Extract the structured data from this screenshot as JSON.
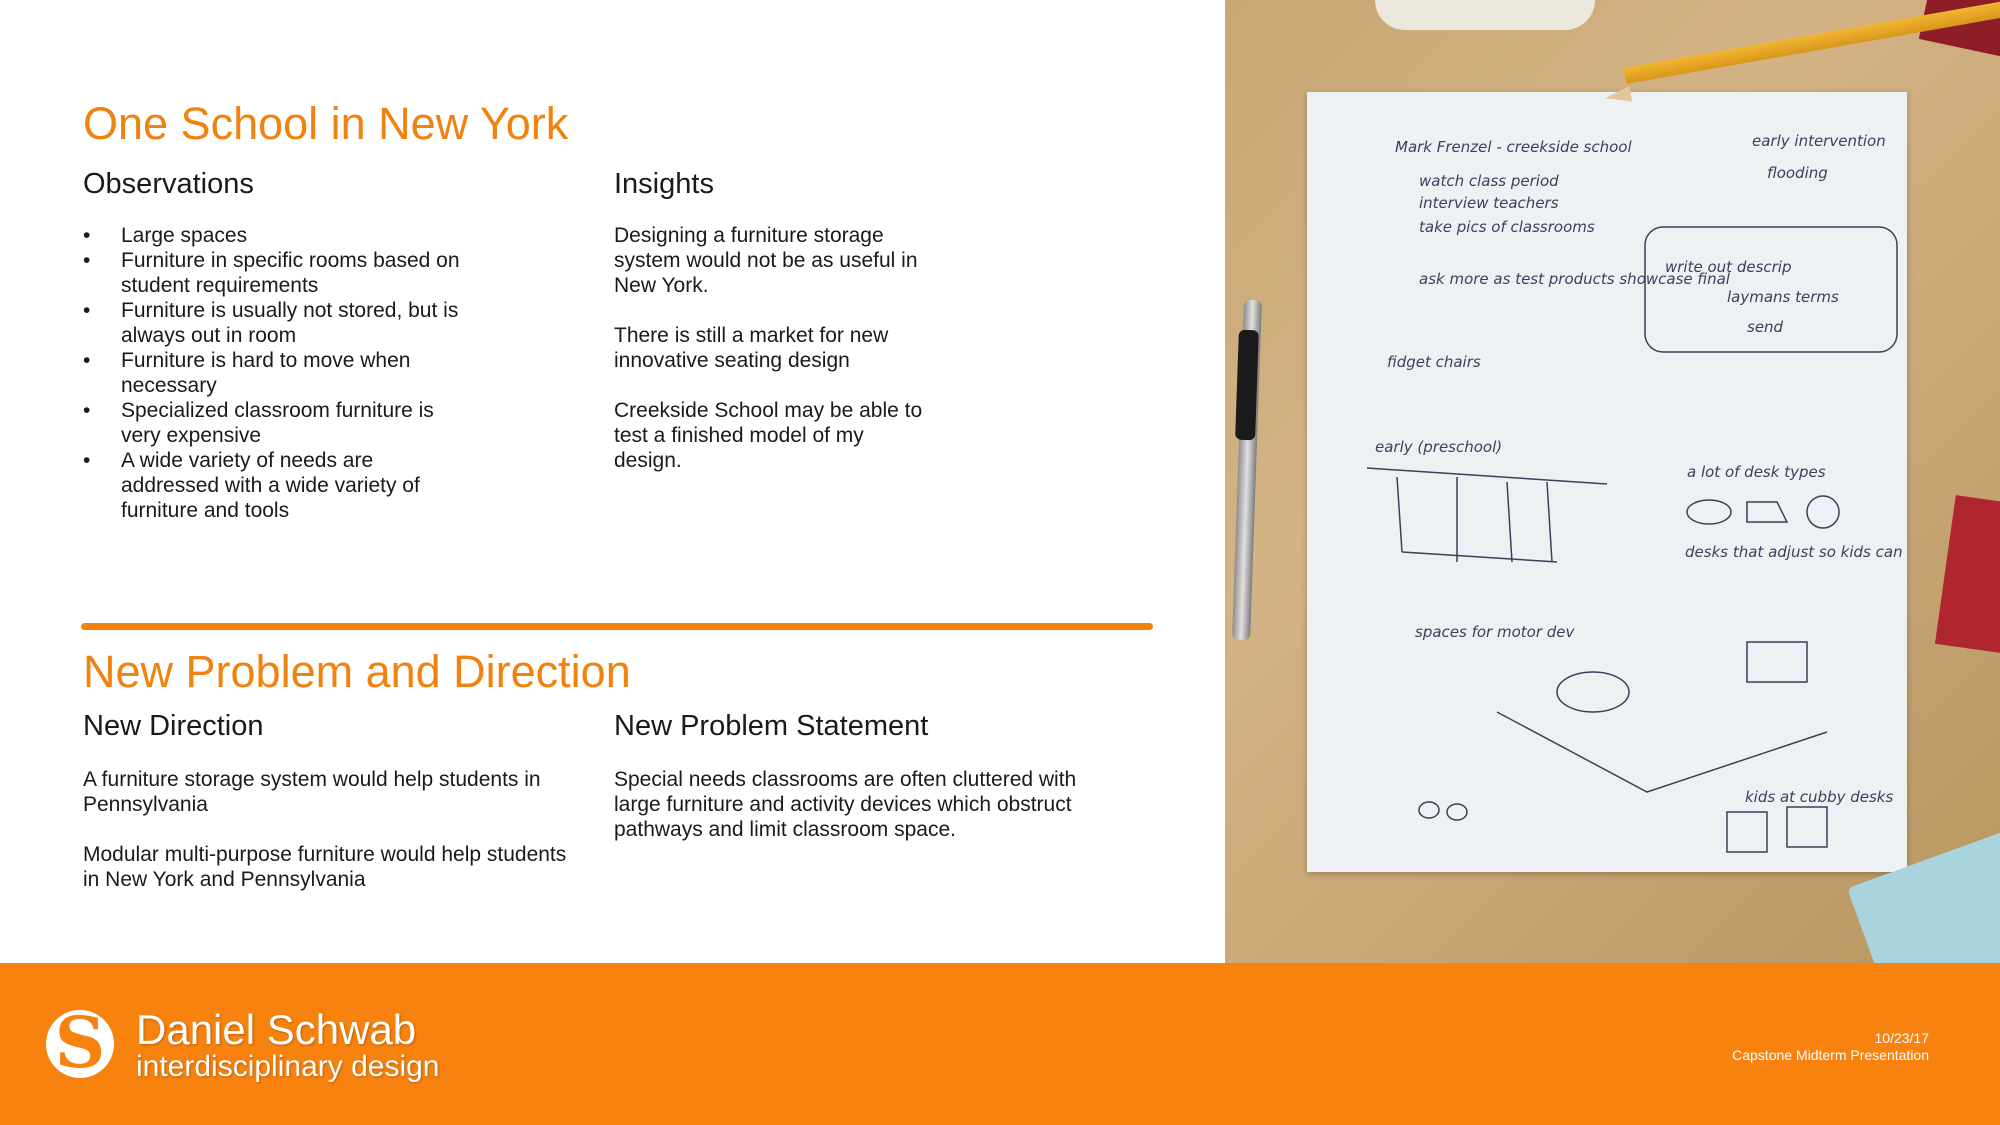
{
  "section1": {
    "title": "One School in New York",
    "observations": {
      "heading": "Observations",
      "items": [
        "Large spaces",
        "Furniture in specific rooms based on student requirements",
        "Furniture is usually not stored, but is always out in room",
        "Furniture is hard to move when necessary",
        "Specialized classroom furniture is very expensive",
        "A wide variety of needs are addressed with a wide variety of furniture and tools"
      ]
    },
    "insights": {
      "heading": "Insights",
      "paragraphs": [
        "Designing a furniture storage system would not be as useful in New York.",
        "There is still a market for new innovative seating design",
        "Creekside School may be able to test a finished model of my design."
      ]
    }
  },
  "section2": {
    "title": "New Problem and Direction",
    "direction": {
      "heading": "New Direction",
      "paragraphs": [
        "A furniture storage system would help students in Pennsylvania",
        "Modular multi-purpose furniture would help students in New York and Pennsylvania"
      ]
    },
    "problem": {
      "heading": "New Problem Statement",
      "paragraphs": [
        "Special needs classrooms are often cluttered with large furniture and activity devices which obstruct pathways and limit classroom space."
      ]
    }
  },
  "sketch_notes": {
    "line1": "Mark Frenzel - creekside school",
    "line2": "watch class period",
    "line3": "interview teachers",
    "line4": "take pics of classrooms",
    "line5": "early intervention",
    "line6": "flooding",
    "line7": "write out descrip",
    "line8": "laymans terms",
    "line9": "send",
    "line10": "fidget chairs",
    "line11": "ask more as test products showcase final",
    "line12": "early (preschool)",
    "line13": "a lot of desk types",
    "line14": "desks that adjust so kids can stand",
    "line15": "spaces for motor dev",
    "line16": "kids at cubby desks"
  },
  "footer": {
    "name": "Daniel Schwab",
    "tagline": "interdisciplinary design",
    "date": "10/23/17",
    "event": "Capstone Midterm Presentation"
  },
  "colors": {
    "accent": "#f0830f",
    "footer": "#f7820d"
  }
}
